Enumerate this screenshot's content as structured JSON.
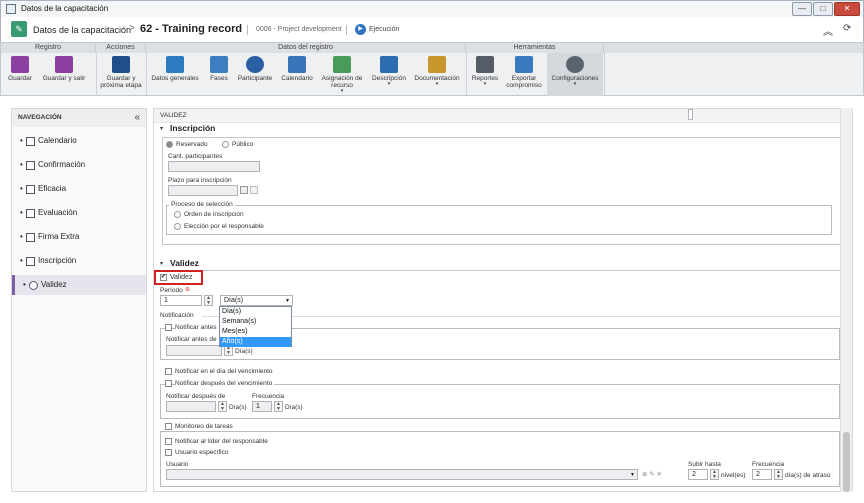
{
  "window": {
    "title": "Datos de la capacitación",
    "min_label": "—",
    "max_label": "□",
    "close_label": "✕"
  },
  "header": {
    "app_icon": "✎",
    "crumb_module": "Datos de la capacitación",
    "crumb_separator": ">",
    "record_title": "62 - Training record",
    "project": "0006 - Project development",
    "status": "Ejecución",
    "status_icon": "▶",
    "collapse_icon": "︽",
    "refresh_icon": "⟳"
  },
  "toolbar": {
    "groups": [
      {
        "label": "Registro"
      },
      {
        "label": "Acciones"
      },
      {
        "label": "Datos del registro"
      },
      {
        "label": "Herramientas"
      }
    ],
    "buttons": [
      {
        "label": "Guardar"
      },
      {
        "label": "Guardar y salir"
      },
      {
        "label": "Guardar y\npróxima etapa"
      },
      {
        "label": "Datos generales"
      },
      {
        "label": "Fases"
      },
      {
        "label": "Participante"
      },
      {
        "label": "Calendario"
      },
      {
        "label": "Asignación de\nrecurso"
      },
      {
        "label": "Descripción"
      },
      {
        "label": "Documentación"
      },
      {
        "label": "Reportes"
      },
      {
        "label": "Exportar\ncompromiso"
      },
      {
        "label": "Configuraciones"
      }
    ],
    "caret": "▾"
  },
  "sidebar": {
    "title": "NAVEGACIÓN",
    "collapse_icon": "«",
    "bullet": "•",
    "items": [
      {
        "label": "Calendario"
      },
      {
        "label": "Confirmación"
      },
      {
        "label": "Eficacia"
      },
      {
        "label": "Evaluación"
      },
      {
        "label": "Firma Extra"
      },
      {
        "label": "Inscripción"
      },
      {
        "label": "Validez"
      }
    ]
  },
  "main": {
    "panel_title": "VALIDEZ",
    "caret": "▾",
    "inscripcion": {
      "title": "Inscripción",
      "radio_reservado": "Reservado",
      "radio_publico": "Público",
      "cant_label": "Cant. participantes",
      "plazo_label": "Plazo para inscripción",
      "proceso_legend": "Proceso de selección",
      "orden_label": "Orden de inscripción",
      "eleccion_label": "Elección por el responsable"
    },
    "validez": {
      "title": "Validez",
      "check_label": "Validez",
      "check_mark": "✔",
      "periodo_label": "Período",
      "required_mark": "⊛",
      "periodo_value": "1",
      "unit_selected": "Día(s)",
      "unit_options": [
        "Día(s)",
        "Semana(s)",
        "Mes(es)",
        "Año(s)"
      ],
      "spin_up": "▲",
      "spin_down": "▼"
    },
    "notificacion": {
      "title": "Notificación",
      "antes_check": "Notificar antes",
      "antes_label": "Notificar antes de",
      "antes_unit": "Día(s)",
      "en_dia_check": "Notificar en el día del vencimiento",
      "despues_check": "Notificar después del vencimiento",
      "despues_label": "Notificar después de",
      "despues_unit": "Día(s)",
      "frecuencia_label": "Frecuencia",
      "frecuencia_value": "1",
      "frecuencia_unit": "Día(s)"
    },
    "monitoreo": {
      "check": "Monitoreo de tareas",
      "lider_check": "Notificar al líder del responsable",
      "usuario_check": "Usuario específico",
      "usuario_label": "Usuario",
      "subir_label": "Subir hasta",
      "subir_value": "2",
      "subir_unit": "nivel(es)",
      "frecuencia_label": "Frecuencia",
      "frecuencia_value": "2",
      "frecuencia_unit": "día(s) de atraso",
      "add_icons": "⊕ ✎ ✕"
    }
  }
}
